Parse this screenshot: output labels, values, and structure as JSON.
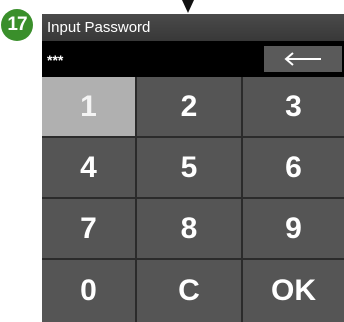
{
  "annotation": {
    "step_number": "17",
    "step_color": "#3a8f2b",
    "pointer_icon": "down-arrow-pointer"
  },
  "dialog": {
    "title": "Input Password",
    "password_value": "***",
    "backspace_icon": "left-arrow-icon"
  },
  "keypad": {
    "keys": [
      {
        "label": "1",
        "state": "pressed"
      },
      {
        "label": "2",
        "state": "normal"
      },
      {
        "label": "3",
        "state": "normal"
      },
      {
        "label": "4",
        "state": "normal"
      },
      {
        "label": "5",
        "state": "normal"
      },
      {
        "label": "6",
        "state": "normal"
      },
      {
        "label": "7",
        "state": "normal"
      },
      {
        "label": "8",
        "state": "normal"
      },
      {
        "label": "9",
        "state": "normal"
      },
      {
        "label": "0",
        "state": "normal"
      },
      {
        "label": "C",
        "state": "normal"
      },
      {
        "label": "OK",
        "state": "normal"
      }
    ]
  },
  "colors": {
    "key_background": "#555555",
    "key_pressed": "#b0b0b0",
    "title_background": "#404040",
    "input_background": "#000000"
  }
}
